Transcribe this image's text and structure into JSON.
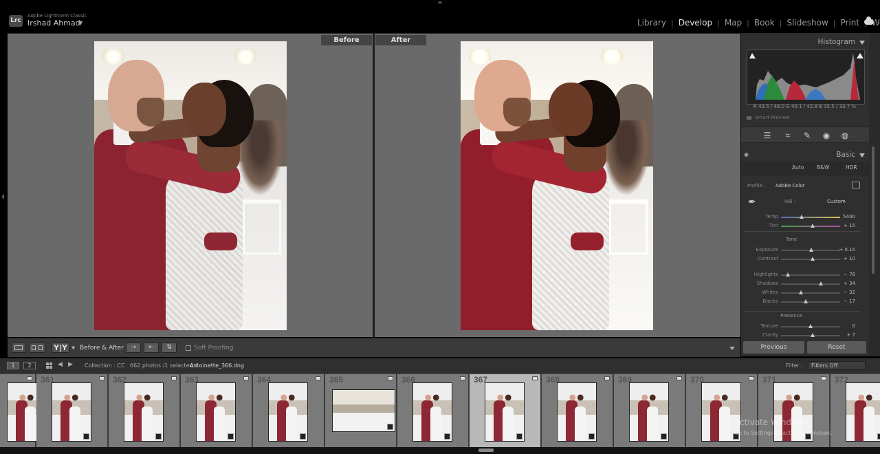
{
  "app": {
    "badge": "Lrc",
    "name": "Adobe Lightroom Classic",
    "user": "Irshad Ahmad"
  },
  "modules": [
    "Library",
    "Develop",
    "Map",
    "Book",
    "Slideshow",
    "Print",
    "Web"
  ],
  "active_module": "Develop",
  "view": {
    "before_label": "Before",
    "after_label": "After"
  },
  "toolbar": {
    "yy_label": "Y|Y",
    "before_after_label": "Before & After :",
    "soft_proofing": "Soft Proofing"
  },
  "right_panel": {
    "histogram_title": "Histogram",
    "rgb": "R  43.5 / 48.0   G  40.1 / 42.8   B  35.5 / 33.7  %",
    "smart_preview": "Smart Preview",
    "basic_title": "Basic",
    "treatments": [
      "Auto",
      "B&W",
      "HDR"
    ],
    "profile_label": "Profile :",
    "profile_value": "Adobe Color",
    "wb_label": "WB :",
    "wb_value": "Custom",
    "tone_label": "Tone",
    "presence_label": "Presence",
    "sliders": [
      {
        "label": "Temp",
        "value": "5400",
        "pos": 0.35
      },
      {
        "label": "Tint",
        "value": "+ 15",
        "pos": 0.53
      },
      {
        "label": "Exposure",
        "value": "+ 0.15",
        "pos": 0.51
      },
      {
        "label": "Contrast",
        "value": "+ 10",
        "pos": 0.53
      },
      {
        "label": "Highlights",
        "value": "− 76",
        "pos": 0.12
      },
      {
        "label": "Shadows",
        "value": "+ 34",
        "pos": 0.67
      },
      {
        "label": "Whites",
        "value": "− 32",
        "pos": 0.34
      },
      {
        "label": "Blacks",
        "value": "− 17",
        "pos": 0.42
      },
      {
        "label": "Texture",
        "value": "0",
        "pos": 0.5
      },
      {
        "label": "Clarity",
        "value": "+ 7",
        "pos": 0.54
      }
    ],
    "previous_btn": "Previous",
    "reset_btn": "Reset"
  },
  "filmbar": {
    "sec1": "1",
    "sec2": "2",
    "collection": "Collection : CC",
    "count": "662 photos /1 selected /",
    "file": "Antoinette_366.dng",
    "filter_label": "Filter :",
    "filter_value": "Filters Off"
  },
  "filmstrip": [
    {
      "num": ""
    },
    {
      "num": "361"
    },
    {
      "num": "362"
    },
    {
      "num": "363"
    },
    {
      "num": "364"
    },
    {
      "num": "365"
    },
    {
      "num": "366"
    },
    {
      "num": "367"
    },
    {
      "num": "368"
    },
    {
      "num": "369"
    },
    {
      "num": "370"
    },
    {
      "num": "371"
    },
    {
      "num": "372"
    }
  ],
  "selected_index": 7,
  "watermark": {
    "title": "Activate Windows",
    "subtitle": "Go to Settings to activate Windows."
  }
}
